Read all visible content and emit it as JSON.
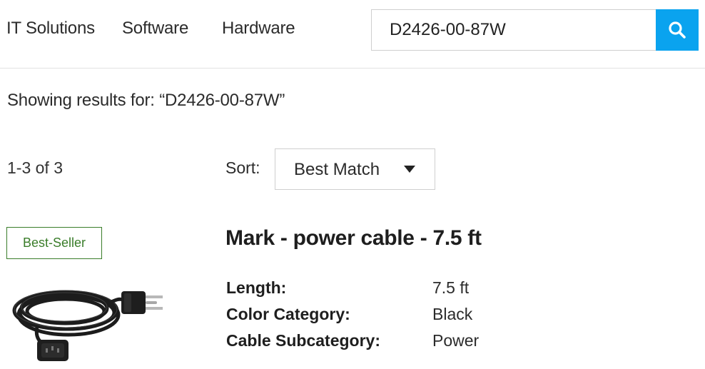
{
  "nav": {
    "items": [
      {
        "label": "IT Solutions"
      },
      {
        "label": "Software"
      },
      {
        "label": "Hardware"
      }
    ]
  },
  "search": {
    "value": "D2426-00-87W",
    "button_icon": "search-icon",
    "button_color": "#0aa3ef"
  },
  "results": {
    "showing_text": "Showing results for: “D2426-00-87W”",
    "count_text": "1-3 of 3"
  },
  "sort": {
    "label": "Sort:",
    "selected": "Best Match",
    "caret_icon": "caret-down-icon"
  },
  "product": {
    "badge": "Best-Seller",
    "badge_color": "#3a7d2a",
    "image_icon": "power-cable-image",
    "title": "Mark - power cable - 7.5 ft",
    "specs": [
      {
        "label": "Length:",
        "value": "7.5 ft"
      },
      {
        "label": "Color Category:",
        "value": "Black"
      },
      {
        "label": "Cable Subcategory:",
        "value": "Power"
      }
    ]
  }
}
